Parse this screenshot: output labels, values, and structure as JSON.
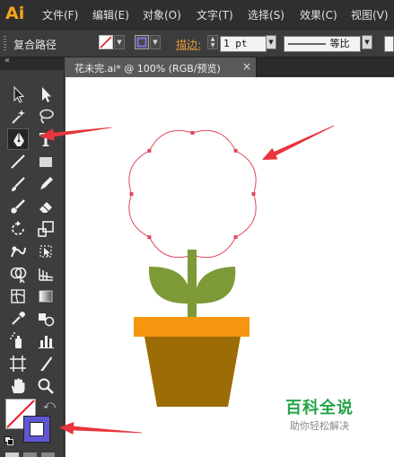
{
  "app": {
    "logo": "Ai",
    "logo_color": "#f7a51c"
  },
  "menu": [
    "文件(F)",
    "编辑(E)",
    "对象(O)",
    "文字(T)",
    "选择(S)",
    "效果(C)",
    "视图(V)"
  ],
  "control_bar": {
    "selection_type": "复合路径",
    "stroke_label": "描边:",
    "stroke_weight": "1 pt",
    "stroke_profile": "等比"
  },
  "document": {
    "tab_title": "花未完.ai* @ 100% (RGB/预览)",
    "close": "×"
  },
  "tools": [
    "selection-tool",
    "direct-selection-tool",
    "magic-wand-tool",
    "lasso-tool",
    "pen-tool",
    "type-tool",
    "line-tool",
    "rectangle-tool",
    "paintbrush-tool",
    "pencil-tool",
    "blob-brush-tool",
    "eraser-tool",
    "rotate-tool",
    "scale-tool",
    "warp-tool",
    "free-transform-tool",
    "shape-builder-tool",
    "graph-tool",
    "mesh-tool",
    "gradient-tool",
    "eyedropper-tool",
    "blend-tool",
    "symbol-sprayer-tool",
    "column-graph-tool",
    "artboard-tool",
    "slice-tool",
    "hand-tool",
    "zoom-tool"
  ],
  "colors": {
    "flower_stroke": "#e2495b",
    "stem": "#7d9a36",
    "leaves": "#7d9a36",
    "pot_rim": "#f6960e",
    "pot_body": "#9c6c06",
    "annotation_arrow": "#e8343c",
    "stroke_swatch": "#5b52c9"
  },
  "watermark": {
    "title": "百科全说",
    "subtitle": "助你轻松解决"
  }
}
